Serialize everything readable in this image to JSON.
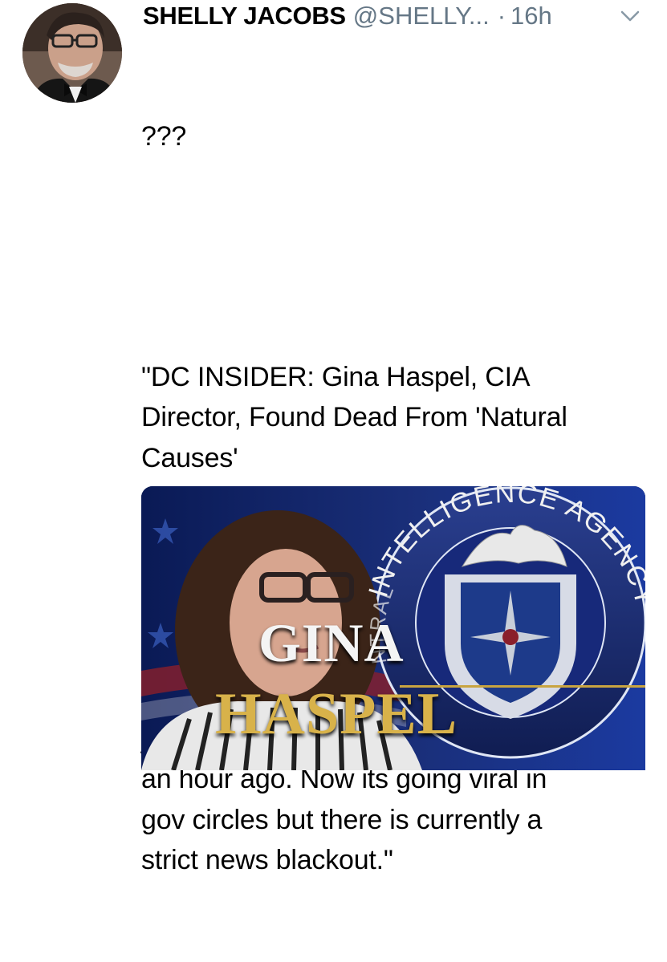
{
  "author": {
    "display_name": "SHELLY JACOBS",
    "handle": "@SHELLY...",
    "separator": "·",
    "timestamp": "16h"
  },
  "tweet": {
    "line_intro": "???",
    "quote_headline": "\"DC INSIDER: Gina Haspel, CIA\nDirector, Found Dead From 'Natural\nCauses'",
    "quote_body": "Shock at Langley right now as this\njust has circulated around DC about\nan hour ago. Now its going viral in\ngov circles but there is currently a\nstrict news blackout.\""
  },
  "media": {
    "seal_text": "INTELLIGENCE AGENCY",
    "seal_text_partial": "NTRAL",
    "name_line_1": "GINA",
    "name_line_2": "HASPEL"
  },
  "icons": {
    "menu": "chevron-down-icon"
  },
  "colors": {
    "secondary_text": "#657786",
    "title_gold": "#d8b24a"
  }
}
